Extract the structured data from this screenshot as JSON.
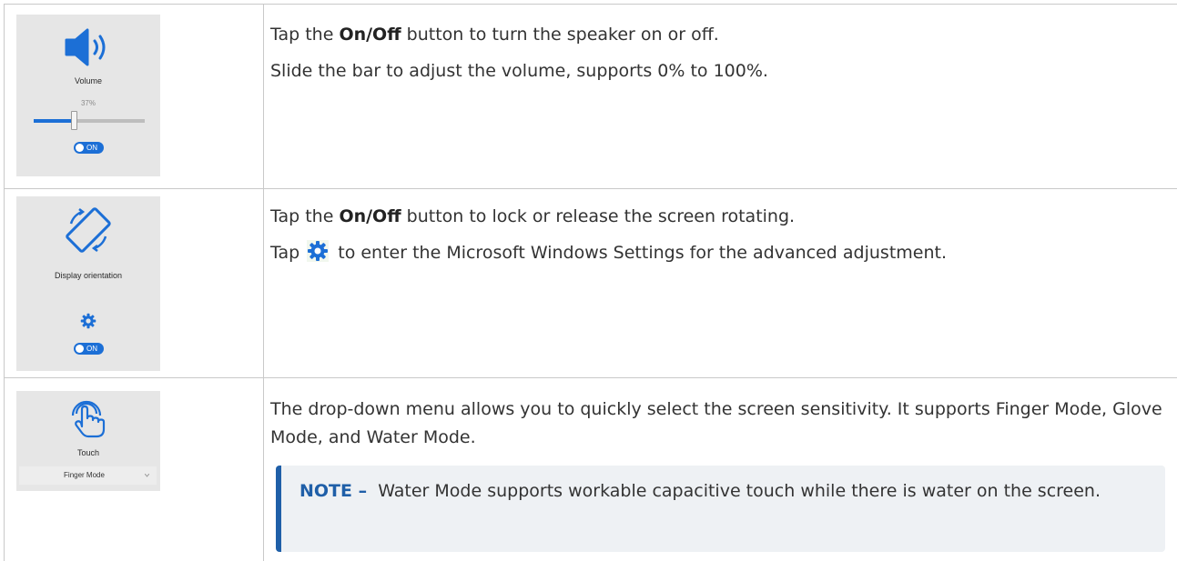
{
  "rows": [
    {
      "panel": {
        "icon": "speaker-icon",
        "label": "Volume",
        "percent": "37%",
        "slider_level": 0.37,
        "toggle_text": "ON"
      },
      "lines": [
        {
          "pre": "Tap the ",
          "bold": "On/Off",
          "post": " button to turn the speaker on or off."
        },
        {
          "text": "Slide the bar to adjust the volume, supports 0% to 100%."
        }
      ]
    },
    {
      "panel": {
        "icon": "rotate-icon",
        "label": "Display orientation",
        "settings_icon": "gear-icon",
        "toggle_text": "ON"
      },
      "lines": [
        {
          "pre": "Tap the ",
          "bold": "On/Off",
          "post": " button to lock or release the screen rotating."
        },
        {
          "pre": "Tap ",
          "icon": "gear-icon",
          "post": " to enter the Microsoft Windows Settings for the advanced adjustment."
        }
      ]
    },
    {
      "panel": {
        "icon": "touch-icon",
        "label": "Touch",
        "select_value": "Finger Mode"
      },
      "paragraph": "The drop-down menu allows you to quickly select the screen sensitivity. It supports Finger Mode, Glove Mode, and Water Mode.",
      "note": {
        "label": "NOTE –",
        "text": "Water Mode supports workable capacitive touch while there is water on the screen."
      }
    }
  ],
  "colors": {
    "accent_blue": "#1c6fd6",
    "note_blue": "#1f5fa8",
    "panel_bg": "#e6e6e6",
    "note_bg": "#eef1f4"
  }
}
